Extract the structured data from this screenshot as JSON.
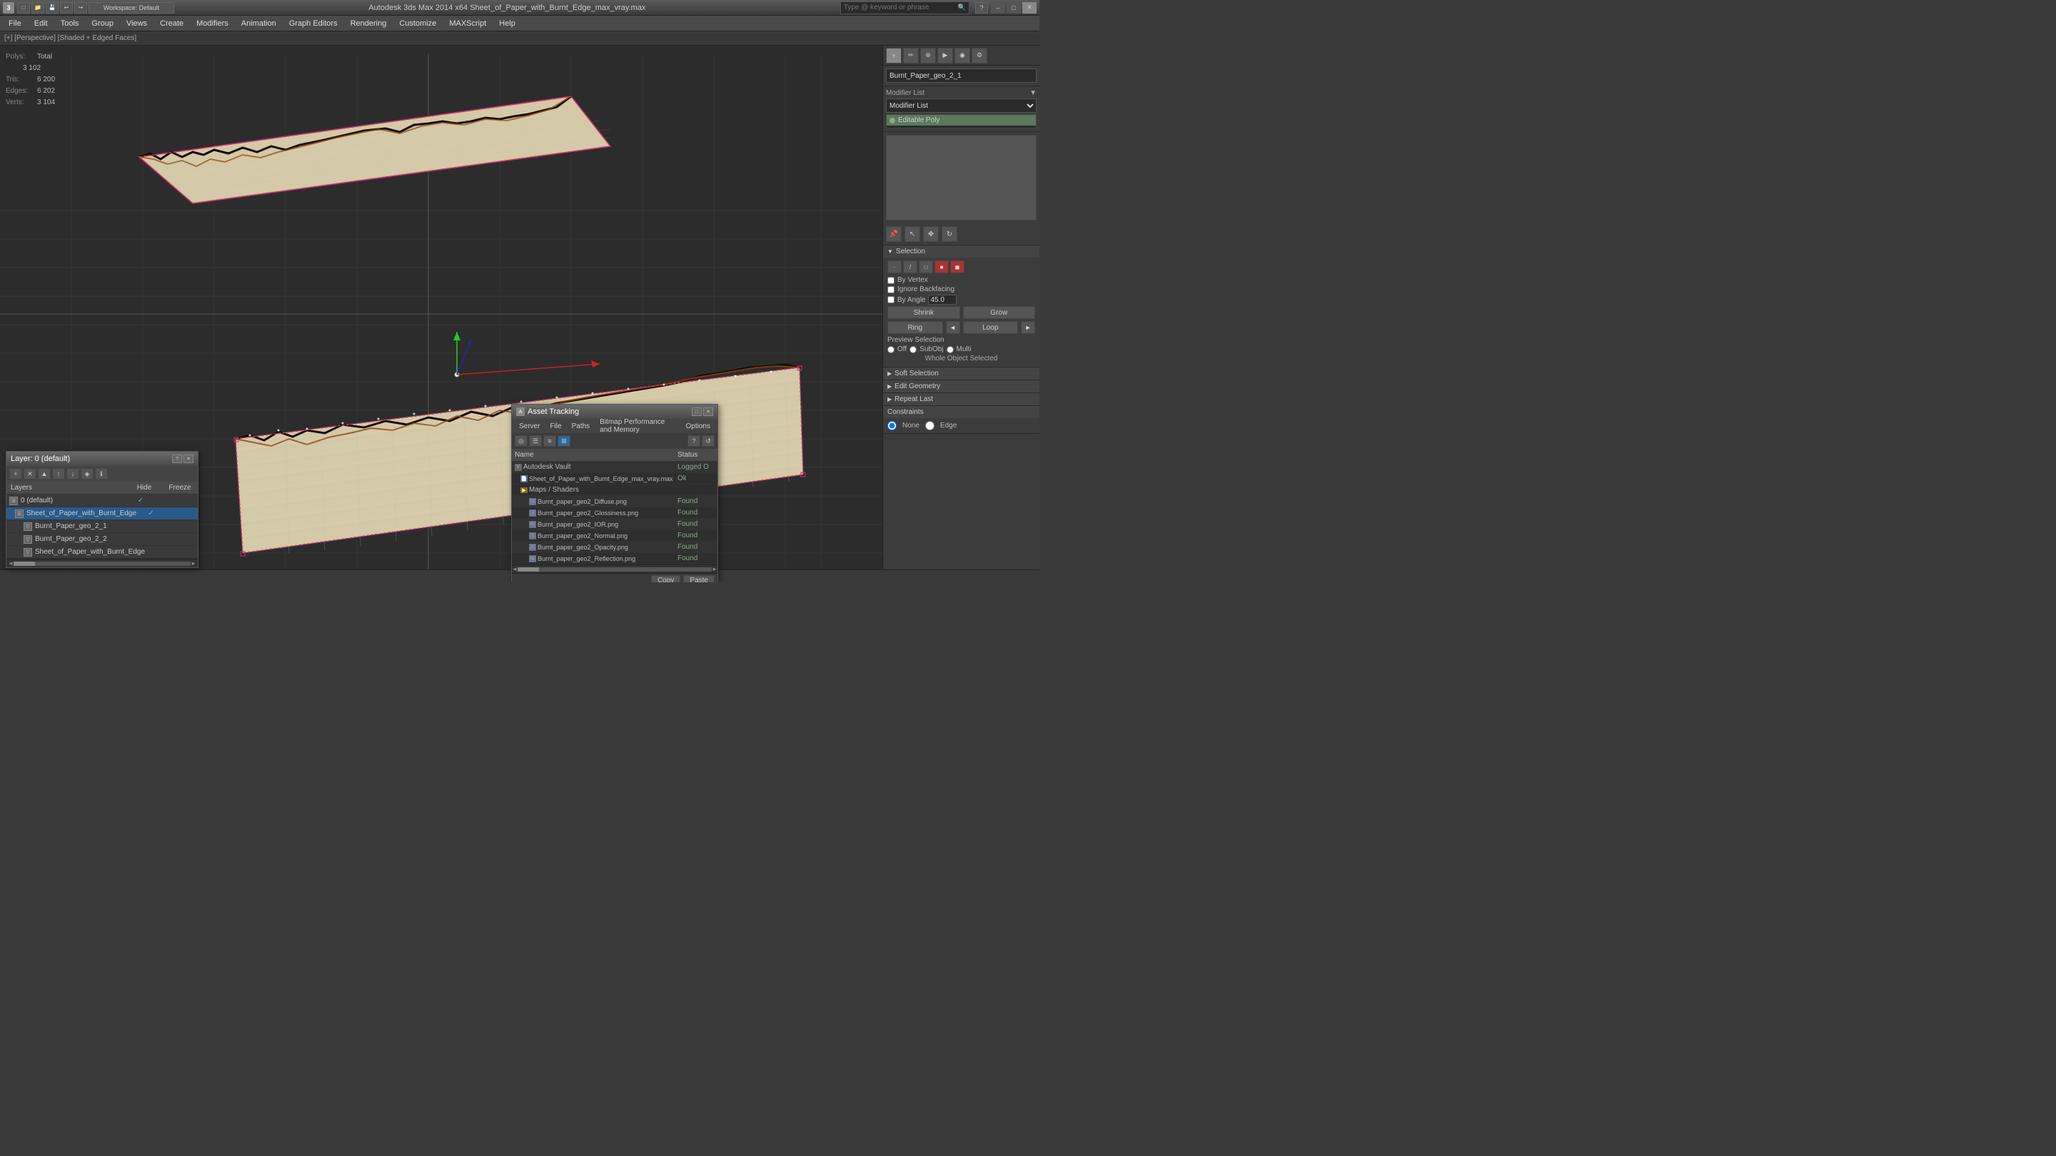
{
  "titlebar": {
    "app_name": "3ds Max",
    "app_icon": "3",
    "workspace": "Workspace: Default",
    "title": "Autodesk 3ds Max 2014 x64      Sheet_of_Paper_with_Burnt_Edge_max_vray.max",
    "search_placeholder": "Type @ keyword or phrase",
    "min_btn": "–",
    "max_btn": "□",
    "close_btn": "✕"
  },
  "menubar": {
    "items": [
      "File",
      "Edit",
      "Tools",
      "Group",
      "Views",
      "Create",
      "Modifiers",
      "Animation",
      "Graph Editors",
      "Rendering",
      "Animation",
      "Customize",
      "MAXScript",
      "Help"
    ]
  },
  "viewport_label": "[+] [Perspective] [Shaded + Edged Faces]",
  "stats": {
    "polys_label": "Polys:",
    "polys_total": "Total",
    "polys_value": "3 102",
    "tris_label": "Tris:",
    "tris_value": "6 200",
    "edges_label": "Edges:",
    "edges_value": "6 202",
    "verts_label": "Verts:",
    "verts_value": "3 104"
  },
  "right_panel": {
    "object_name": "Burnt_Paper_geo_2_1",
    "modifier_list_label": "Modifier List",
    "modifier_dropdown_placeholder": "Modifier List",
    "modifiers": [
      {
        "name": "Editable Poly",
        "active": true
      }
    ],
    "sections": {
      "selection_label": "Selection",
      "soft_selection_label": "Soft Selection",
      "edit_geometry_label": "Edit Geometry",
      "repeat_last_label": "Repeat Last",
      "constraints_label": "Constraints",
      "none_label": "None",
      "edge_label": "Edge"
    },
    "selection": {
      "by_vertex_label": "By Vertex",
      "ignore_backfacing_label": "Ignore Backfacing",
      "by_angle_label": "By Angle",
      "angle_value": "45.0",
      "shrink_label": "Shrink",
      "grow_label": "Grow",
      "ring_label": "Ring",
      "loop_label": "Loop",
      "preview_off_label": "Off",
      "preview_subobj_label": "SubObj",
      "preview_multi_label": "Multi",
      "whole_object_selected": "Whole Object Selected"
    }
  },
  "layers_window": {
    "title": "Layer: 0 (default)",
    "close_btn": "✕",
    "question_btn": "?",
    "columns": {
      "layers": "Layers",
      "hide": "Hide",
      "freeze": "Freeze"
    },
    "items": [
      {
        "name": "0 (default)",
        "indent": 0,
        "selected": false,
        "hide_check": true,
        "freeze_check": false
      },
      {
        "name": "Sheet_of_Paper_with_Burnt_Edge",
        "indent": 1,
        "selected": true,
        "hide_check": false,
        "freeze_check": false
      },
      {
        "name": "Burnt_Paper_geo_2_1",
        "indent": 2,
        "selected": false,
        "hide_check": false,
        "freeze_check": false
      },
      {
        "name": "Burnt_Paper_geo_2_2",
        "indent": 2,
        "selected": false,
        "hide_check": false,
        "freeze_check": false
      },
      {
        "name": "Sheet_of_Paper_with_Burnt_Edge",
        "indent": 2,
        "selected": false,
        "hide_check": false,
        "freeze_check": false
      }
    ]
  },
  "asset_window": {
    "title": "Asset Tracking",
    "close_btn": "✕",
    "maximize_btn": "□",
    "menus": [
      "Server",
      "File",
      "Paths",
      "Bitmap Performance and Memory",
      "Options"
    ],
    "columns": {
      "name": "Name",
      "status": "Status"
    },
    "rows": [
      {
        "name": "Autodesk Vault",
        "indent": 0,
        "status": "Logged O",
        "type": "vault"
      },
      {
        "name": "Sheet_of_Paper_with_Burnt_Edge_max_vray.max",
        "indent": 1,
        "status": "Ok",
        "type": "file"
      },
      {
        "name": "Maps / Shaders",
        "indent": 1,
        "status": "",
        "type": "folder"
      },
      {
        "name": "Burnt_paper_geo2_Diffuse.png",
        "indent": 2,
        "status": "Found",
        "type": "png"
      },
      {
        "name": "Burnt_paper_geo2_Glossiness.png",
        "indent": 2,
        "status": "Found",
        "type": "png"
      },
      {
        "name": "Burnt_paper_geo2_IOR.png",
        "indent": 2,
        "status": "Found",
        "type": "png"
      },
      {
        "name": "Burnt_paper_geo2_Normal.png",
        "indent": 2,
        "status": "Found",
        "type": "png"
      },
      {
        "name": "Burnt_paper_geo2_Opacity.png",
        "indent": 2,
        "status": "Found",
        "type": "png"
      },
      {
        "name": "Burnt_paper_geo2_Reflection.png",
        "indent": 2,
        "status": "Found",
        "type": "png"
      }
    ],
    "bottom_btn1": "Copy",
    "bottom_btn2": "Paste"
  },
  "statusbar": {
    "text": ""
  }
}
